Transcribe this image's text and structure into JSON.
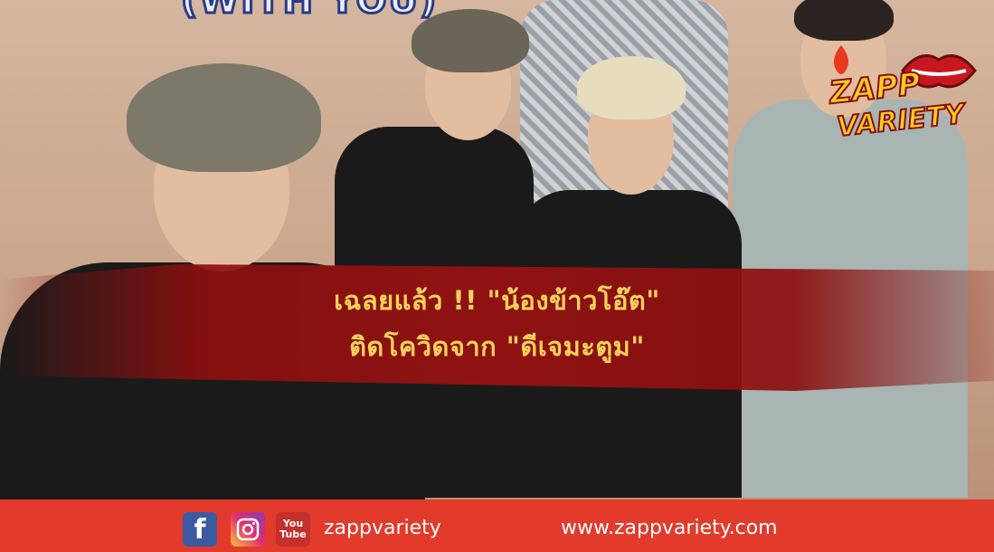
{
  "header": {
    "partial_title": "(WITH YOU)"
  },
  "headline": {
    "line1": "เฉลยแล้ว !! \"น้องข้าวโอ๊ต\"",
    "line2": "ติดโควิดจาก \"ดีเจมะตูม\""
  },
  "logo": {
    "line1": "ZAPP",
    "line2": "VARIETY"
  },
  "footer": {
    "facebook_icon": "f",
    "youtube_icon_top": "You",
    "youtube_icon_bottom": "Tube",
    "handle": "zappvariety",
    "url": "www.zappvariety.com"
  },
  "colors": {
    "banner": "#8c0f0f",
    "headline_text": "#f7d25a",
    "footer_bg": "#e23a2b",
    "logo_text": "#ffcf1f"
  }
}
